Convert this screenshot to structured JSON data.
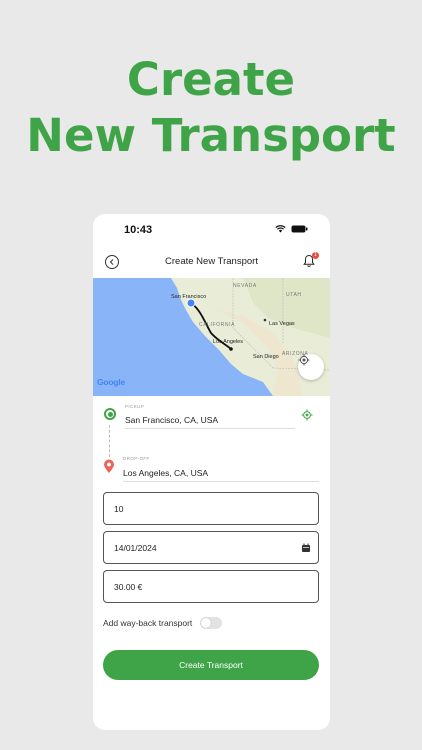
{
  "promo": {
    "line1": "Create",
    "line2": "New Transport"
  },
  "status_bar": {
    "time": "10:43"
  },
  "nav": {
    "title": "Create New Transport",
    "notification_count": "1"
  },
  "map": {
    "states": [
      "NEVADA",
      "UTAH",
      "CALIFORNIA",
      "ARIZONA"
    ],
    "cities": [
      "San Francisco",
      "Las Vegas",
      "Los Angeles",
      "San Diego"
    ],
    "attribution": "Google"
  },
  "route": {
    "pickup": {
      "caption": "PICKUP",
      "value": "San Francisco, CA, USA"
    },
    "dropoff": {
      "caption": "DROP-OFF",
      "value": "Los Angeles, CA, USA"
    }
  },
  "form": {
    "quantity": "10",
    "date": "14/01/2024",
    "price": "30.00 €"
  },
  "toggle": {
    "label": "Add way-back transport",
    "on": false
  },
  "submit": {
    "label": "Create Transport"
  },
  "colors": {
    "brand_green": "#3fa447",
    "ocean": "#8ab4f8",
    "land": "#e9edd8",
    "badge": "#e74c3c"
  },
  "icons": [
    "wifi-icon",
    "battery-icon",
    "back-arrow-icon",
    "bell-icon",
    "locate-icon",
    "pickup-marker-icon",
    "dropoff-pin-icon",
    "target-icon",
    "calendar-icon"
  ]
}
